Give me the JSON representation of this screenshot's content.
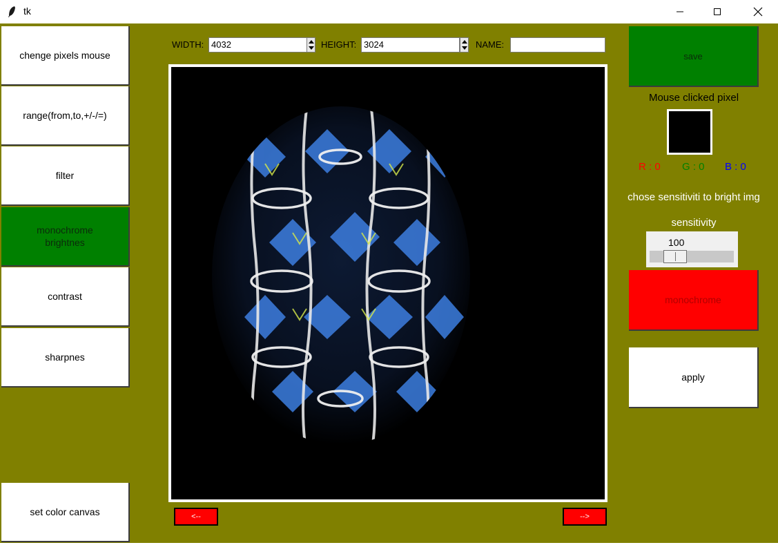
{
  "window": {
    "title": "tk"
  },
  "sidebar": {
    "items": [
      {
        "label": "chenge pixels mouse"
      },
      {
        "label": "range(from,to,+/-/=)"
      },
      {
        "label": "filter"
      },
      {
        "label": "monochrome\nbrightnes",
        "active": true
      },
      {
        "label": "contrast"
      },
      {
        "label": "sharpnes"
      }
    ],
    "set_color_label": "set color canvas"
  },
  "size": {
    "width_label": "WIDTH:",
    "width_value": "4032",
    "height_label": "HEIGHT:",
    "height_value": "3024",
    "name_label": "NAME:",
    "name_value": ""
  },
  "nav": {
    "prev_label": "<--",
    "next_label": "-->"
  },
  "right_panel": {
    "save_label": "save",
    "mouse_pixel_label": "Mouse clicked pixel",
    "r_label": "R : 0",
    "g_label": "G : 0",
    "b_label": "B : 0",
    "sensitivity_hint": "chose sensitiviti to bright img",
    "sensitivity_label": "sensitivity",
    "sensitivity_value": "100",
    "monochrome_label": "monochrome",
    "apply_label": "apply"
  },
  "colors": {
    "background": "#808000",
    "active_green": "#008000",
    "red": "#ff0000",
    "r_color": "#ff0000",
    "g_color": "#008000",
    "b_color": "#0000ff"
  }
}
